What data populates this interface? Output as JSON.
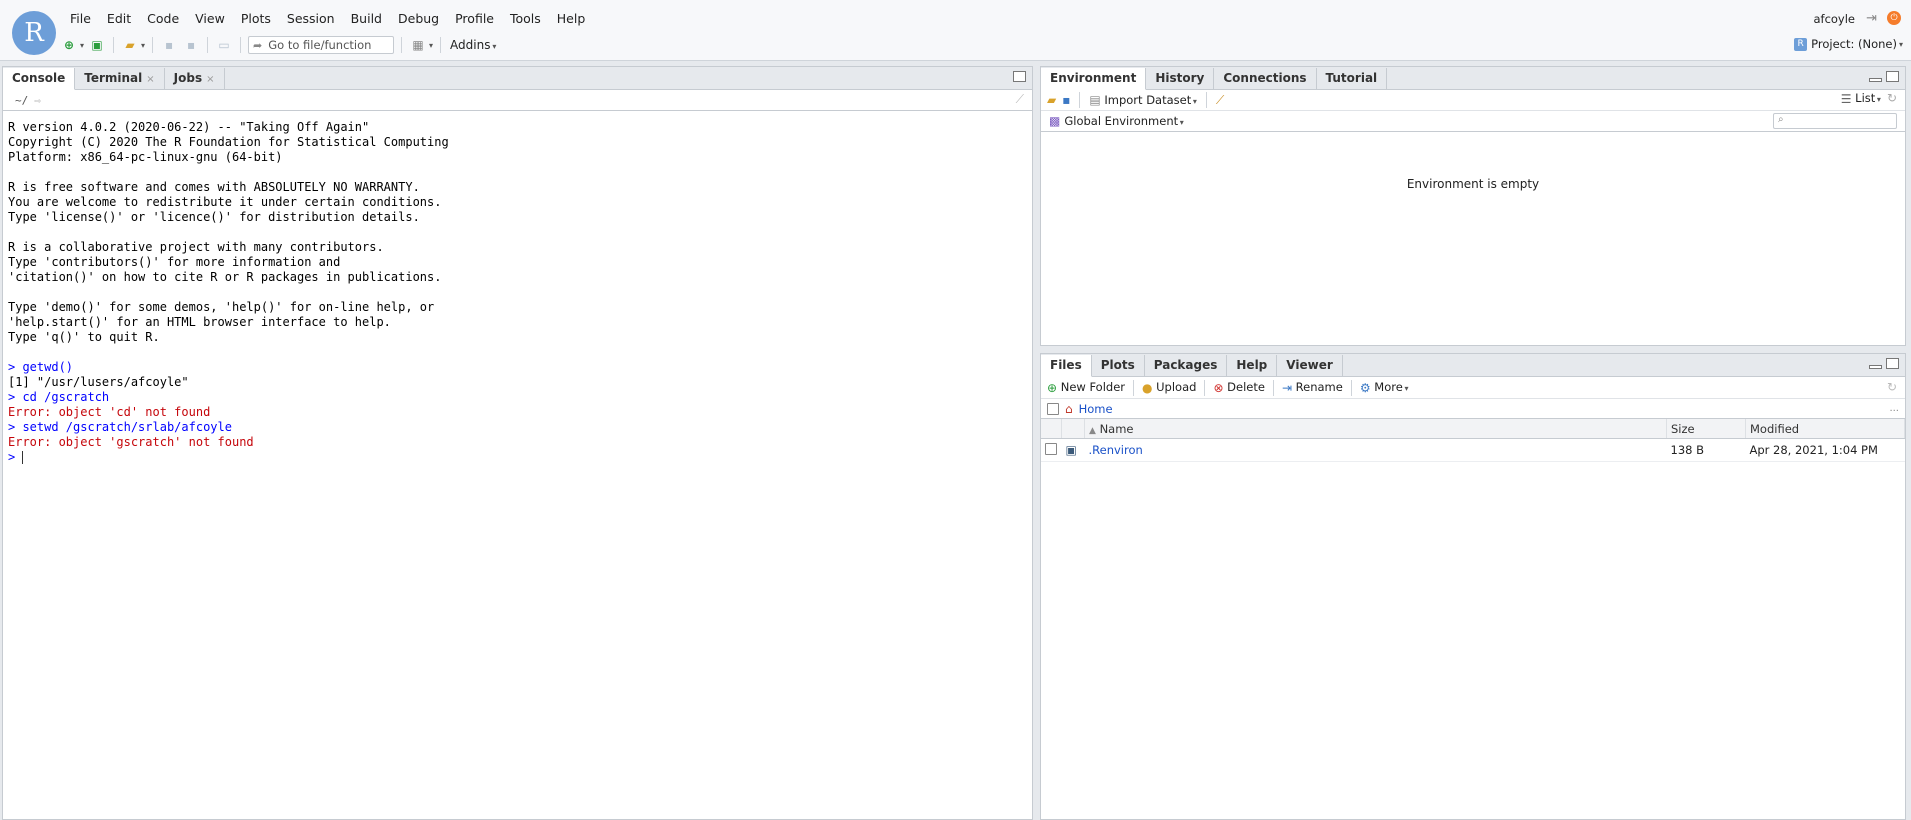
{
  "menubar": {
    "items": [
      "File",
      "Edit",
      "Code",
      "View",
      "Plots",
      "Session",
      "Build",
      "Debug",
      "Profile",
      "Tools",
      "Help"
    ]
  },
  "logo": {
    "letter": "R"
  },
  "toolbar": {
    "goto_placeholder": "Go to file/function",
    "addins_label": "Addins"
  },
  "header": {
    "user": "afcoyle",
    "project": "Project: (None)"
  },
  "console": {
    "tabs": [
      {
        "label": "Console"
      },
      {
        "label": "Terminal",
        "closable": "×"
      },
      {
        "label": "Jobs",
        "closable": "×"
      }
    ],
    "path": "~/",
    "lines": [
      {
        "type": "out",
        "text": "R version 4.0.2 (2020-06-22) -- \"Taking Off Again\""
      },
      {
        "type": "out",
        "text": "Copyright (C) 2020 The R Foundation for Statistical Computing"
      },
      {
        "type": "out",
        "text": "Platform: x86_64-pc-linux-gnu (64-bit)"
      },
      {
        "type": "out",
        "text": ""
      },
      {
        "type": "out",
        "text": "R is free software and comes with ABSOLUTELY NO WARRANTY."
      },
      {
        "type": "out",
        "text": "You are welcome to redistribute it under certain conditions."
      },
      {
        "type": "out",
        "text": "Type 'license()' or 'licence()' for distribution details."
      },
      {
        "type": "out",
        "text": ""
      },
      {
        "type": "out",
        "text": "R is a collaborative project with many contributors."
      },
      {
        "type": "out",
        "text": "Type 'contributors()' for more information and"
      },
      {
        "type": "out",
        "text": "'citation()' on how to cite R or R packages in publications."
      },
      {
        "type": "out",
        "text": ""
      },
      {
        "type": "out",
        "text": "Type 'demo()' for some demos, 'help()' for on-line help, or"
      },
      {
        "type": "out",
        "text": "'help.start()' for an HTML browser interface to help."
      },
      {
        "type": "out",
        "text": "Type 'q()' to quit R."
      },
      {
        "type": "out",
        "text": ""
      },
      {
        "type": "in",
        "text": "> getwd()"
      },
      {
        "type": "out",
        "text": "[1] \"/usr/lusers/afcoyle\""
      },
      {
        "type": "in",
        "text": "> cd /gscratch"
      },
      {
        "type": "err",
        "text": "Error: object 'cd' not found"
      },
      {
        "type": "in",
        "text": "> setwd /gscratch/srlab/afcoyle"
      },
      {
        "type": "err",
        "text": "Error: object 'gscratch' not found"
      }
    ],
    "prompt": "> "
  },
  "environment": {
    "tabs": [
      {
        "label": "Environment"
      },
      {
        "label": "History"
      },
      {
        "label": "Connections"
      },
      {
        "label": "Tutorial"
      }
    ],
    "import_label": "Import Dataset",
    "list_label": "List",
    "scope_label": "Global Environment",
    "empty_message": "Environment is empty"
  },
  "files": {
    "tabs": [
      {
        "label": "Files"
      },
      {
        "label": "Plots"
      },
      {
        "label": "Packages"
      },
      {
        "label": "Help"
      },
      {
        "label": "Viewer"
      }
    ],
    "actions": {
      "new_folder": "New Folder",
      "upload": "Upload",
      "delete": "Delete",
      "rename": "Rename",
      "more": "More"
    },
    "path_home": "Home",
    "path_more": "...",
    "columns": {
      "name": "Name",
      "size": "Size",
      "modified": "Modified"
    },
    "rows": [
      {
        "name": ".Renviron",
        "size": "138 B",
        "modified": "Apr 28, 2021, 1:04 PM"
      }
    ]
  }
}
